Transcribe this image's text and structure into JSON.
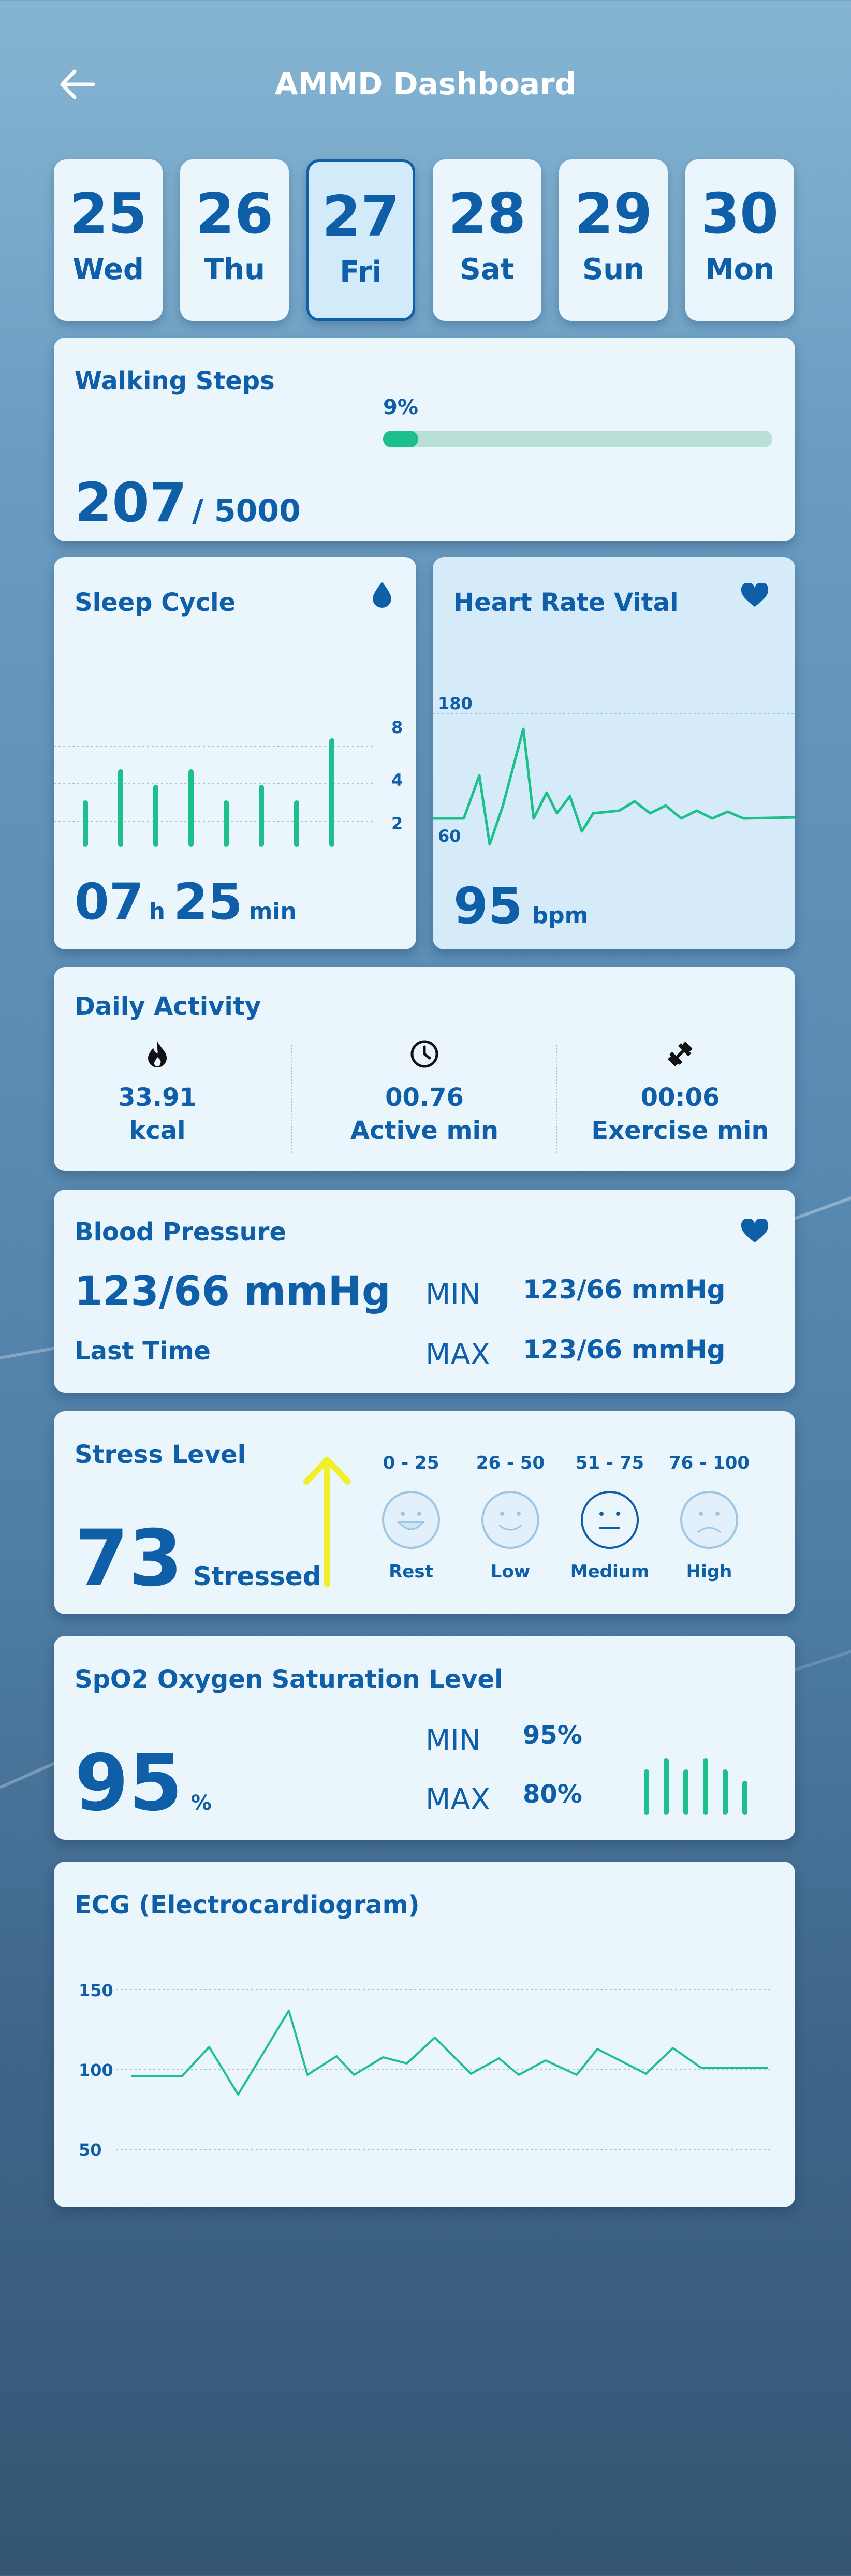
{
  "header": {
    "title": "AMMD Dashboard"
  },
  "days": [
    {
      "num": "25",
      "name": "Wed"
    },
    {
      "num": "26",
      "name": "Thu"
    },
    {
      "num": "27",
      "name": "Fri"
    },
    {
      "num": "28",
      "name": "Sat"
    },
    {
      "num": "29",
      "name": "Sun"
    },
    {
      "num": "30",
      "name": "Mon"
    }
  ],
  "selected_day_index": 2,
  "steps": {
    "title": "Walking Steps",
    "percent_label": "9%",
    "progress": 0.09,
    "value": "207",
    "goal": "/ 5000"
  },
  "sleep": {
    "title": "Sleep Cycle",
    "icon": "drop-icon",
    "axis": {
      "top": "8",
      "mid": "4",
      "low": "2"
    },
    "hours": "07",
    "h_unit": "h",
    "minutes": "25",
    "m_unit": "min",
    "bars": [
      3,
      5,
      4,
      5,
      3,
      4,
      3,
      7
    ]
  },
  "heart": {
    "title": "Heart Rate Vital",
    "icon": "heart-icon",
    "axis_top": "180",
    "axis_bottom": "60",
    "value": "95",
    "unit": "bpm"
  },
  "activity": {
    "title": "Daily Activity",
    "items": [
      {
        "icon": "flame-icon",
        "value": "33.91",
        "label": "kcal"
      },
      {
        "icon": "clock-icon",
        "value": "00.76",
        "label": "Active min"
      },
      {
        "icon": "dumbbell-icon",
        "value": "00:06",
        "label": "Exercise min"
      }
    ]
  },
  "bp": {
    "title": "Blood Pressure",
    "icon": "heart-icon",
    "value": "123/66 mmHg",
    "last": "Last Time",
    "min_label": "MIN",
    "min_value": "123/66 mmHg",
    "max_label": "MAX",
    "max_value": "123/66 mmHg"
  },
  "stress": {
    "title": "Stress Level",
    "value": "73",
    "state": "Stressed",
    "levels": [
      {
        "range": "0 - 25",
        "label": "Rest"
      },
      {
        "range": "26 - 50",
        "label": "Low"
      },
      {
        "range": "51 - 75",
        "label": "Medium"
      },
      {
        "range": "76 - 100",
        "label": "High"
      }
    ],
    "active_index": 2,
    "arrow_color": "#f1ee2a"
  },
  "spo2": {
    "title": "SpO2 Oxygen Saturation Level",
    "value": "95",
    "unit": "%",
    "min_label": "MIN",
    "min_value": "95%",
    "max_label": "MAX",
    "max_value": "80%",
    "bars": [
      4,
      5,
      4,
      5,
      4,
      3
    ]
  },
  "ecg": {
    "title": "ECG (Electrocardiogram)",
    "axis": {
      "top": "150",
      "mid": "100",
      "low": "50"
    }
  },
  "colors": {
    "accent": "#0f5fa8",
    "green": "#1dbf8a",
    "card": "#eaf5fc",
    "card_blue": "#d6ebfa"
  }
}
